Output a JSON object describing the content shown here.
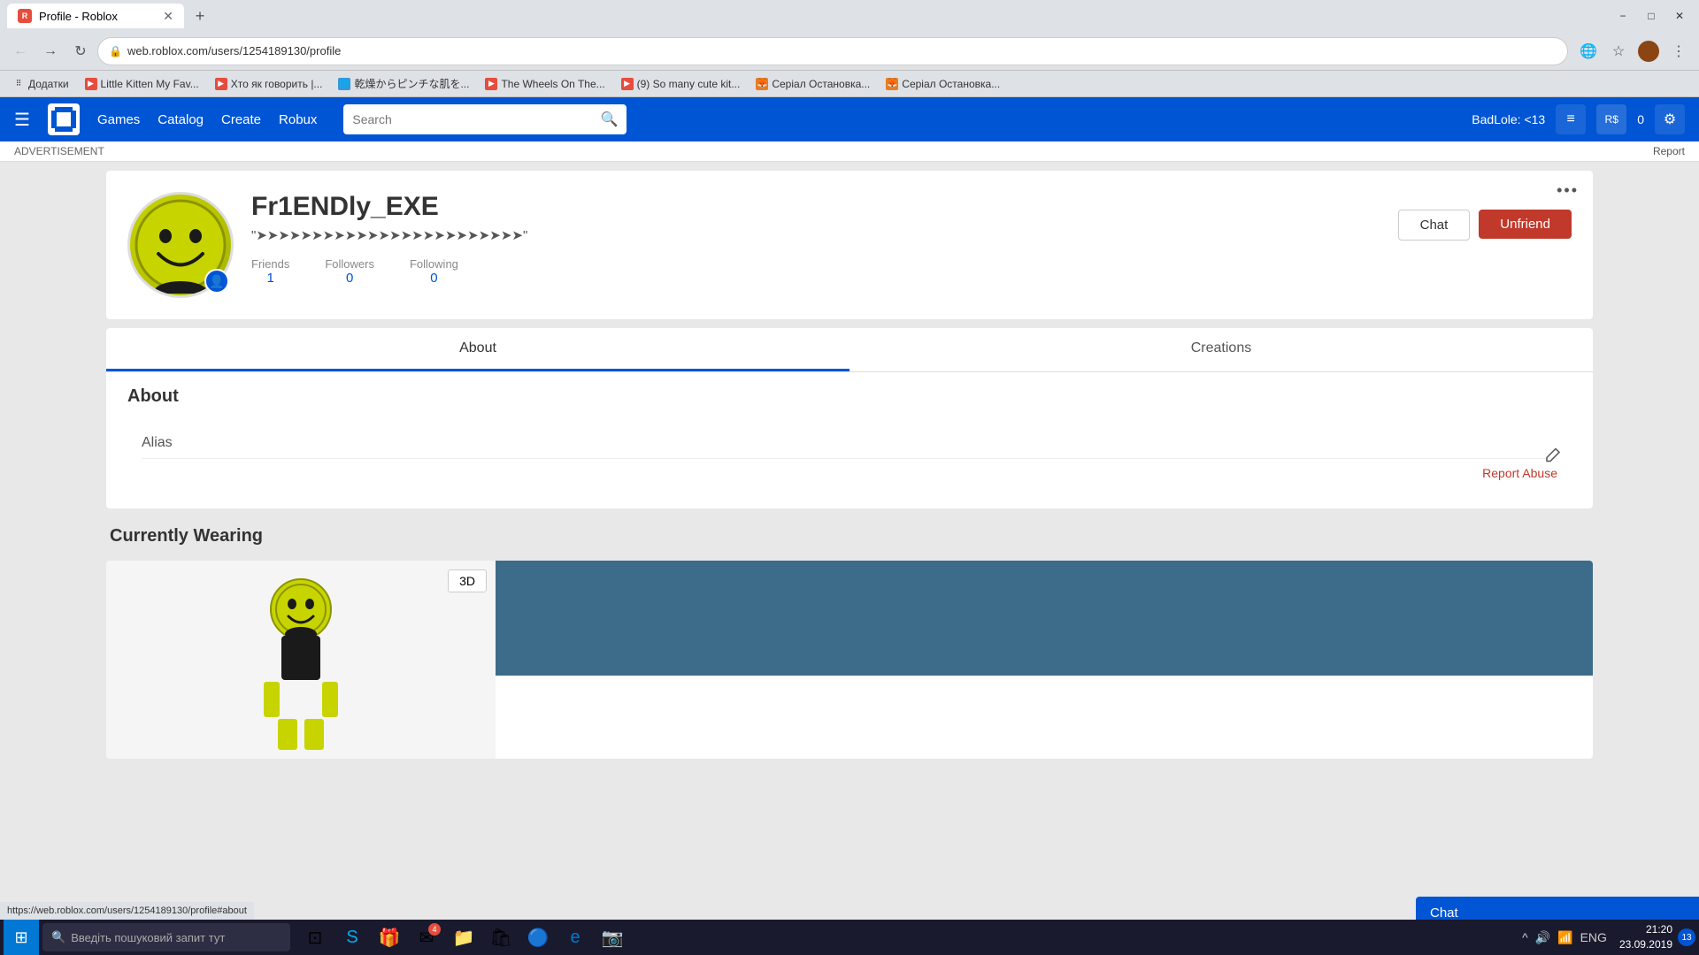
{
  "browser": {
    "tab_title": "Profile - Roblox",
    "tab_url": "web.roblox.com/users/1254189130/profile",
    "tab_url_full": "https://web.roblox.com/users/1254189130/profile",
    "status_bar_url": "https://web.roblox.com/users/1254189130/profile#about",
    "bookmarks": [
      {
        "label": "Додатки",
        "type": "apps"
      },
      {
        "label": "Little Kitten My Fav...",
        "type": "youtube"
      },
      {
        "label": "Хто як говорить |...",
        "type": "youtube"
      },
      {
        "label": "乾燥からピンチな肌を...",
        "type": "globe"
      },
      {
        "label": "The Wheels On The...",
        "type": "youtube"
      },
      {
        "label": "(9) So many cute kit...",
        "type": "youtube"
      },
      {
        "label": "Серіал Остановка...",
        "type": "fox"
      },
      {
        "label": "Серіал Остановка...",
        "type": "fox"
      }
    ],
    "report_link": "Report"
  },
  "roblox": {
    "header": {
      "nav_items": [
        "Games",
        "Catalog",
        "Create",
        "Robux"
      ],
      "search_placeholder": "Search",
      "username": "BadLole: <13"
    },
    "profile": {
      "username": "Fr1ENDly_EXE",
      "status": "\"➤➤➤➤➤➤➤➤➤➤➤➤➤➤➤➤➤➤➤➤➤➤➤➤\"",
      "friends_label": "Friends",
      "friends_count": "1",
      "followers_label": "Followers",
      "followers_count": "0",
      "following_label": "Following",
      "following_count": "0",
      "chat_btn": "Chat",
      "unfriend_btn": "Unfriend"
    },
    "tabs": {
      "about_label": "About",
      "creations_label": "Creations"
    },
    "about": {
      "section_title": "About",
      "alias_label": "Alias",
      "report_abuse": "Report Abuse"
    },
    "wearing": {
      "section_title": "Currently Wearing",
      "btn_3d": "3D"
    },
    "chat_bubble": "Chat",
    "ad_label": "ADVERTISEMENT"
  },
  "taskbar": {
    "search_placeholder": "Введіть пошуковий запит тут",
    "language": "ENG",
    "time": "21:20",
    "date": "23.09.2019",
    "notification_count": "13"
  }
}
